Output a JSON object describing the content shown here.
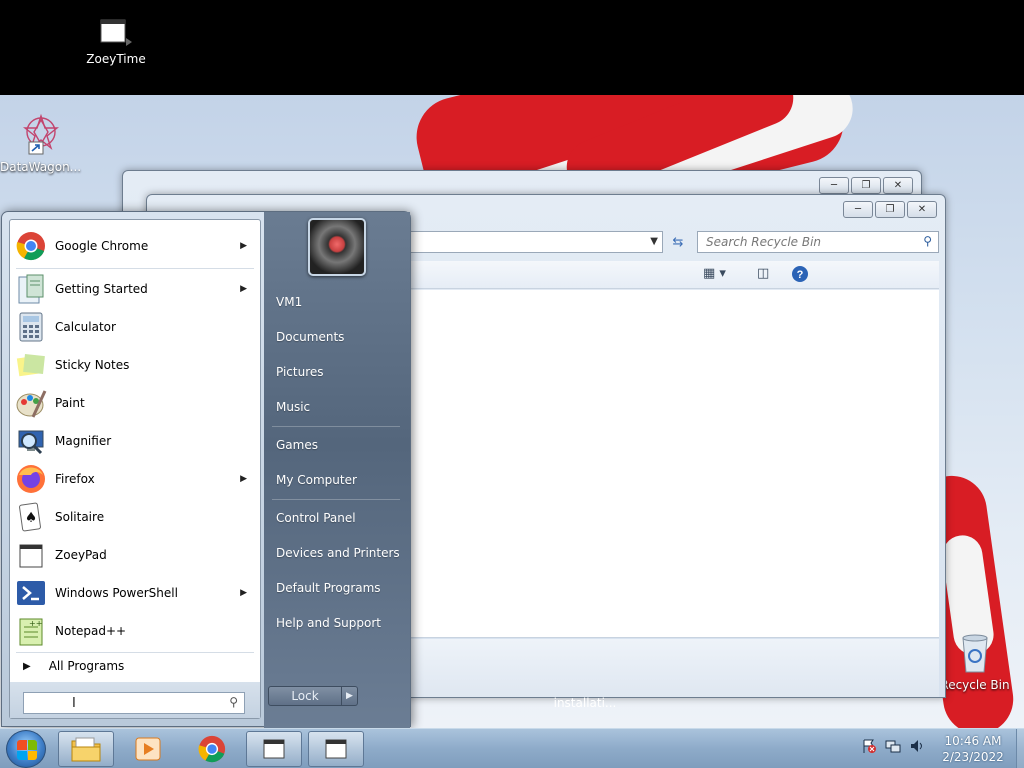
{
  "desktop": {
    "icons": [
      {
        "label": "ZoeyTime"
      },
      {
        "label": "DataWagon..."
      },
      {
        "label": "Recycle Bin"
      }
    ],
    "status_text": "installati..."
  },
  "explorer": {
    "search_placeholder": "Search Recycle Bin"
  },
  "start_menu": {
    "programs": [
      {
        "label": "Google Chrome",
        "icon": "chrome-icon",
        "has_submenu": true
      },
      {
        "label": "Getting Started",
        "icon": "getting-started-icon",
        "has_submenu": true
      },
      {
        "label": "Calculator",
        "icon": "calculator-icon",
        "has_submenu": false
      },
      {
        "label": "Sticky Notes",
        "icon": "sticky-notes-icon",
        "has_submenu": false
      },
      {
        "label": "Paint",
        "icon": "paint-icon",
        "has_submenu": false
      },
      {
        "label": "Magnifier",
        "icon": "magnifier-icon",
        "has_submenu": false
      },
      {
        "label": "Firefox",
        "icon": "firefox-icon",
        "has_submenu": true
      },
      {
        "label": "Solitaire",
        "icon": "solitaire-icon",
        "has_submenu": false
      },
      {
        "label": "ZoeyPad",
        "icon": "zoeypad-icon",
        "has_submenu": false
      },
      {
        "label": "Windows PowerShell",
        "icon": "powershell-icon",
        "has_submenu": true
      },
      {
        "label": "Notepad++",
        "icon": "notepadpp-icon",
        "has_submenu": false
      }
    ],
    "all_programs": "All Programs",
    "places": [
      {
        "label": "VM1"
      },
      {
        "label": "Documents"
      },
      {
        "label": "Pictures"
      },
      {
        "label": "Music"
      },
      {
        "label": "Games"
      },
      {
        "label": "My Computer"
      },
      {
        "label": "Control Panel"
      },
      {
        "label": "Devices and Printers"
      },
      {
        "label": "Default Programs"
      },
      {
        "label": "Help and Support"
      }
    ],
    "lock_label": "Lock"
  },
  "taskbar": {
    "clock_time": "10:46 AM",
    "clock_date": "2/23/2022"
  },
  "colors": {
    "flag_red": "#d81d24",
    "accent_blue": "#3b6db5"
  }
}
